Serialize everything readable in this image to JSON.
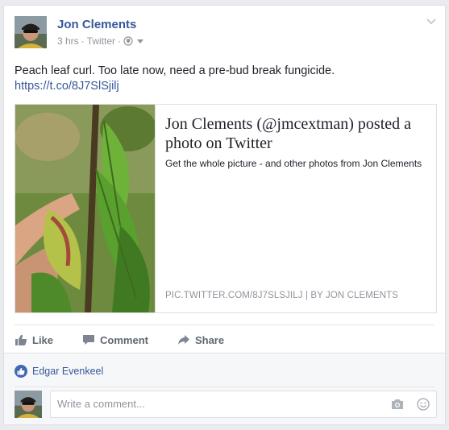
{
  "post": {
    "author": "Jon Clements",
    "time": "3 hrs",
    "source": "Twitter",
    "text": "Peach leaf curl. Too late now, need a pre-bud break fungicide.",
    "link": "https://t.co/8J7SlSjilj"
  },
  "preview": {
    "title": "Jon Clements (@jmcextman) posted a photo on Twitter",
    "description": "Get the whole picture - and other photos from Jon Clements",
    "source": "PIC.TWITTER.COM/8J7SLSJILJ",
    "separator": "|",
    "byline": "BY JON CLEMENTS"
  },
  "actions": {
    "like": "Like",
    "comment": "Comment",
    "share": "Share"
  },
  "reactions": {
    "liker": "Edgar Evenkeel"
  },
  "comment": {
    "placeholder": "Write a comment..."
  },
  "colors": {
    "link": "#365899",
    "meta": "#90949c",
    "action": "#606770",
    "like_badge": "#4267b2"
  },
  "icons": [
    "chevron-down-icon",
    "globe-icon",
    "caret-down-icon",
    "like-icon",
    "comment-icon",
    "share-icon",
    "like-badge-icon",
    "camera-icon",
    "smiley-icon"
  ]
}
